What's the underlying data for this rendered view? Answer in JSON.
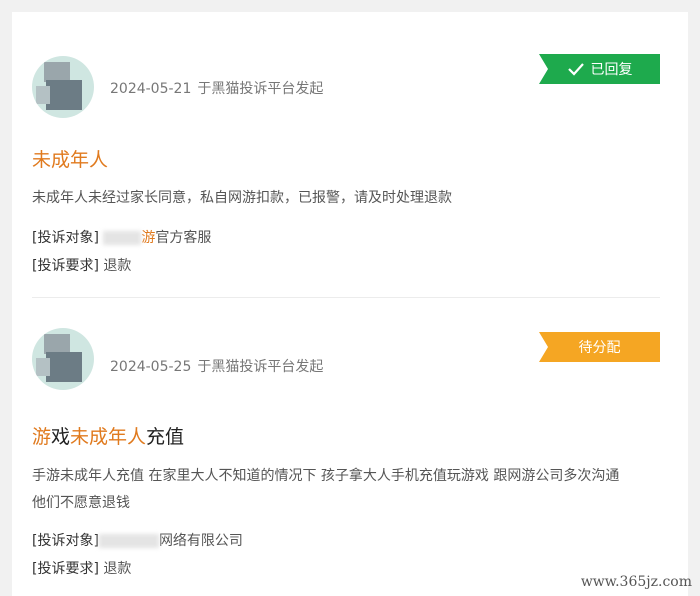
{
  "complaints": [
    {
      "date": "2024-05-21",
      "source": "于黑猫投诉平台发起",
      "status": "已回复",
      "title_parts": [
        {
          "text": "未成年人",
          "hl": true
        }
      ],
      "description": "未成年人未经过家长同意，私自网游扣款，已报警，请及时处理退款",
      "target_label": "[投诉对象]",
      "target_hl": "游",
      "target_value": "官方客服",
      "request_label": "[投诉要求]",
      "request_value": "退款"
    },
    {
      "date": "2024-05-25",
      "source": "于黑猫投诉平台发起",
      "status": "待分配",
      "title_parts": [
        {
          "text": "游",
          "hl": true
        },
        {
          "text": "戏",
          "hl": false
        },
        {
          "text": "未成年人",
          "hl": true
        },
        {
          "text": "充值",
          "hl": false
        }
      ],
      "description_line1": "手游未成年人充值 在家里大人不知道的情况下 孩子拿大人手机充值玩游戏 跟网游公司多次沟通",
      "description_line2": "他们不愿意退钱",
      "target_label": "[投诉对象]",
      "target_value": "网络有限公司",
      "request_label": "[投诉要求]",
      "request_value": "退款"
    }
  ],
  "watermark": "www.365jz.com",
  "colors": {
    "done": "#1eaa4d",
    "pending": "#f5a623",
    "highlight": "#e07a1e"
  }
}
